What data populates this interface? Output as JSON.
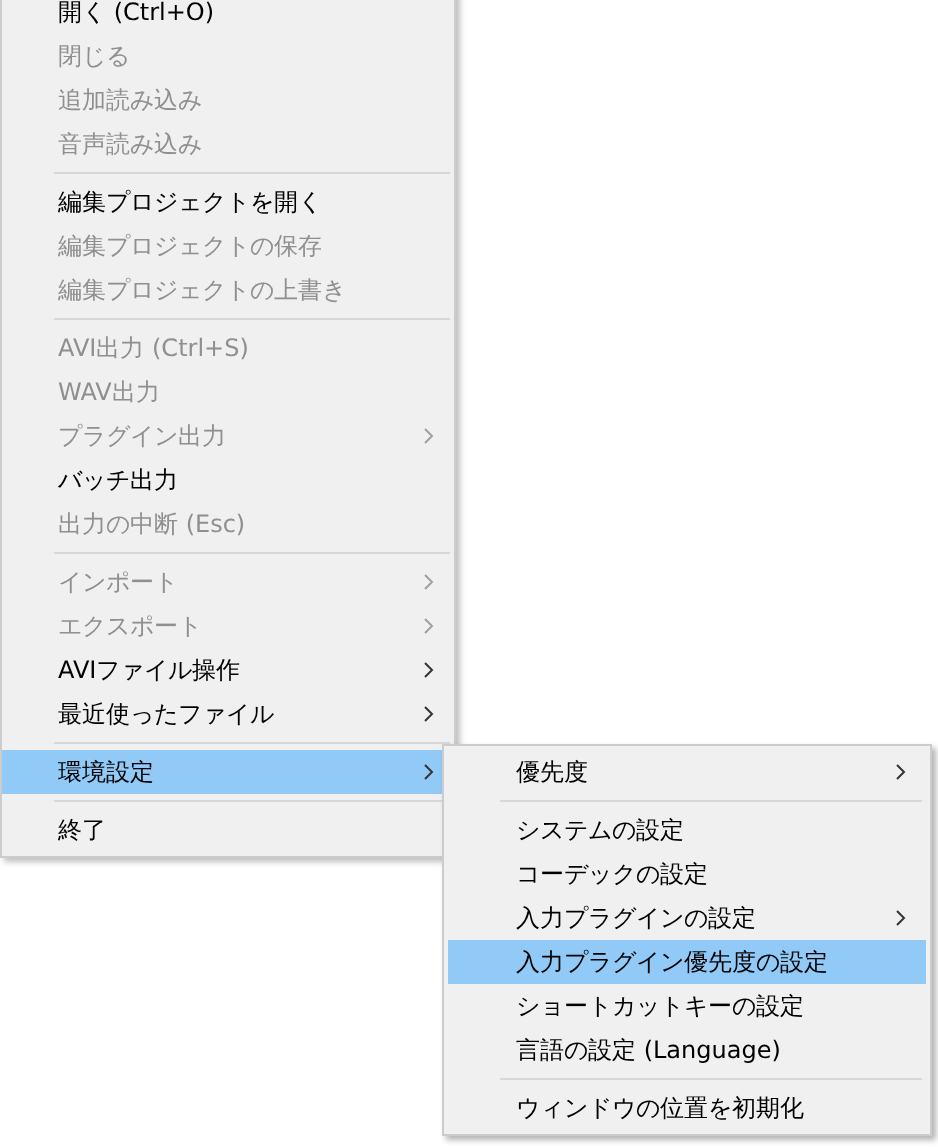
{
  "menu": {
    "items": [
      {
        "kind": "item",
        "label": "開く (Ctrl+O)",
        "disabled": false,
        "selected": false,
        "submenu": false
      },
      {
        "kind": "item",
        "label": "閉じる",
        "disabled": true,
        "selected": false,
        "submenu": false
      },
      {
        "kind": "item",
        "label": "追加読み込み",
        "disabled": true,
        "selected": false,
        "submenu": false
      },
      {
        "kind": "item",
        "label": "音声読み込み",
        "disabled": true,
        "selected": false,
        "submenu": false
      },
      {
        "kind": "separator"
      },
      {
        "kind": "item",
        "label": "編集プロジェクトを開く",
        "disabled": false,
        "selected": false,
        "submenu": false
      },
      {
        "kind": "item",
        "label": "編集プロジェクトの保存",
        "disabled": true,
        "selected": false,
        "submenu": false
      },
      {
        "kind": "item",
        "label": "編集プロジェクトの上書き",
        "disabled": true,
        "selected": false,
        "submenu": false
      },
      {
        "kind": "separator"
      },
      {
        "kind": "item",
        "label": "AVI出力 (Ctrl+S)",
        "disabled": true,
        "selected": false,
        "submenu": false
      },
      {
        "kind": "item",
        "label": "WAV出力",
        "disabled": true,
        "selected": false,
        "submenu": false
      },
      {
        "kind": "item",
        "label": "プラグイン出力",
        "disabled": true,
        "selected": false,
        "submenu": true
      },
      {
        "kind": "item",
        "label": "バッチ出力",
        "disabled": false,
        "selected": false,
        "submenu": false
      },
      {
        "kind": "item",
        "label": "出力の中断 (Esc)",
        "disabled": true,
        "selected": false,
        "submenu": false
      },
      {
        "kind": "separator"
      },
      {
        "kind": "item",
        "label": "インポート",
        "disabled": true,
        "selected": false,
        "submenu": true
      },
      {
        "kind": "item",
        "label": "エクスポート",
        "disabled": true,
        "selected": false,
        "submenu": true
      },
      {
        "kind": "item",
        "label": "AVIファイル操作",
        "disabled": false,
        "selected": false,
        "submenu": true
      },
      {
        "kind": "item",
        "label": "最近使ったファイル",
        "disabled": false,
        "selected": false,
        "submenu": true
      },
      {
        "kind": "separator"
      },
      {
        "kind": "item",
        "label": "環境設定",
        "disabled": false,
        "selected": true,
        "submenu": true
      },
      {
        "kind": "separator"
      },
      {
        "kind": "item",
        "label": "終了",
        "disabled": false,
        "selected": false,
        "submenu": false
      }
    ]
  },
  "submenu": {
    "items": [
      {
        "kind": "item",
        "label": "優先度",
        "disabled": false,
        "selected": false,
        "submenu": true
      },
      {
        "kind": "separator"
      },
      {
        "kind": "item",
        "label": "システムの設定",
        "disabled": false,
        "selected": false,
        "submenu": false
      },
      {
        "kind": "item",
        "label": "コーデックの設定",
        "disabled": false,
        "selected": false,
        "submenu": false
      },
      {
        "kind": "item",
        "label": "入力プラグインの設定",
        "disabled": false,
        "selected": false,
        "submenu": true
      },
      {
        "kind": "item",
        "label": "入力プラグイン優先度の設定",
        "disabled": false,
        "selected": true,
        "submenu": false
      },
      {
        "kind": "item",
        "label": "ショートカットキーの設定",
        "disabled": false,
        "selected": false,
        "submenu": false
      },
      {
        "kind": "item",
        "label": "言語の設定 (Language)",
        "disabled": false,
        "selected": false,
        "submenu": false
      },
      {
        "kind": "separator"
      },
      {
        "kind": "item",
        "label": "ウィンドウの位置を初期化",
        "disabled": false,
        "selected": false,
        "submenu": false
      }
    ]
  }
}
